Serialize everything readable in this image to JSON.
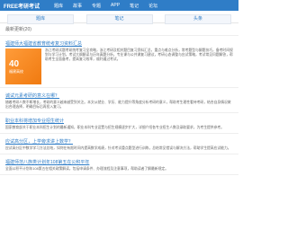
{
  "brand": "FREE考研考试",
  "nav": [
    "题库",
    "故事",
    "专题",
    "APP",
    "笔记",
    "论坛"
  ],
  "tabs": [
    "题库",
    "笔记",
    "头条"
  ],
  "section_title": "最新更新(20)",
  "articles": [
    {
      "title": "福建师大福建省教育统考复习资料汇总",
      "body": "浙江考研试题考研统考复习全攻略，浙江考研及相关题目复习资料汇总，重点与难点分析，常考题型与解题技巧，备考时间规划与学习计划，考试大纲解读与历年真题分析，专业课与公共课复习建议，考研心态调整与应试策略，考试常见问题解答，帮助考生全面备考，提高复习效率，顺利通过考试。",
      "thumb_big": "40",
      "thumb_small": "福建高校"
    },
    {
      "title": "诚试元素考研的意义在哪？",
      "body": "随着考研人数不断增长，考研的意义越来越受到关注。本文从就业、学历、能力提升等角度分析考研的意义，帮助考生理性看待考研，结合自身情况做出合理选择，明确目标后再投入复习。"
    },
    {
      "title": "职业本科将增加专业招生统计",
      "body": "国家教育部关于职业本科招生计划的最新通知，职业本科专业设置与招生规模逐步扩大，详细介绍各专业招生人数及录取要求，为考生提供参考。"
    },
    {
      "title": "应试高分区，上学旁求讲上数学？",
      "body": "应试高分区中数学学习方法总结，如何在有限时间内提高数学成绩，针对考试重点题型进行训练，总结常见错误与解决方法，帮助学生提高应试能力。"
    },
    {
      "title": "福建师范八族类计划年108第五在公积平年",
      "body": "全面公积平计划年108第五在相关政策解读，包括申请条件、办理流程及注意事项，帮助读者了解最新规定。"
    }
  ]
}
